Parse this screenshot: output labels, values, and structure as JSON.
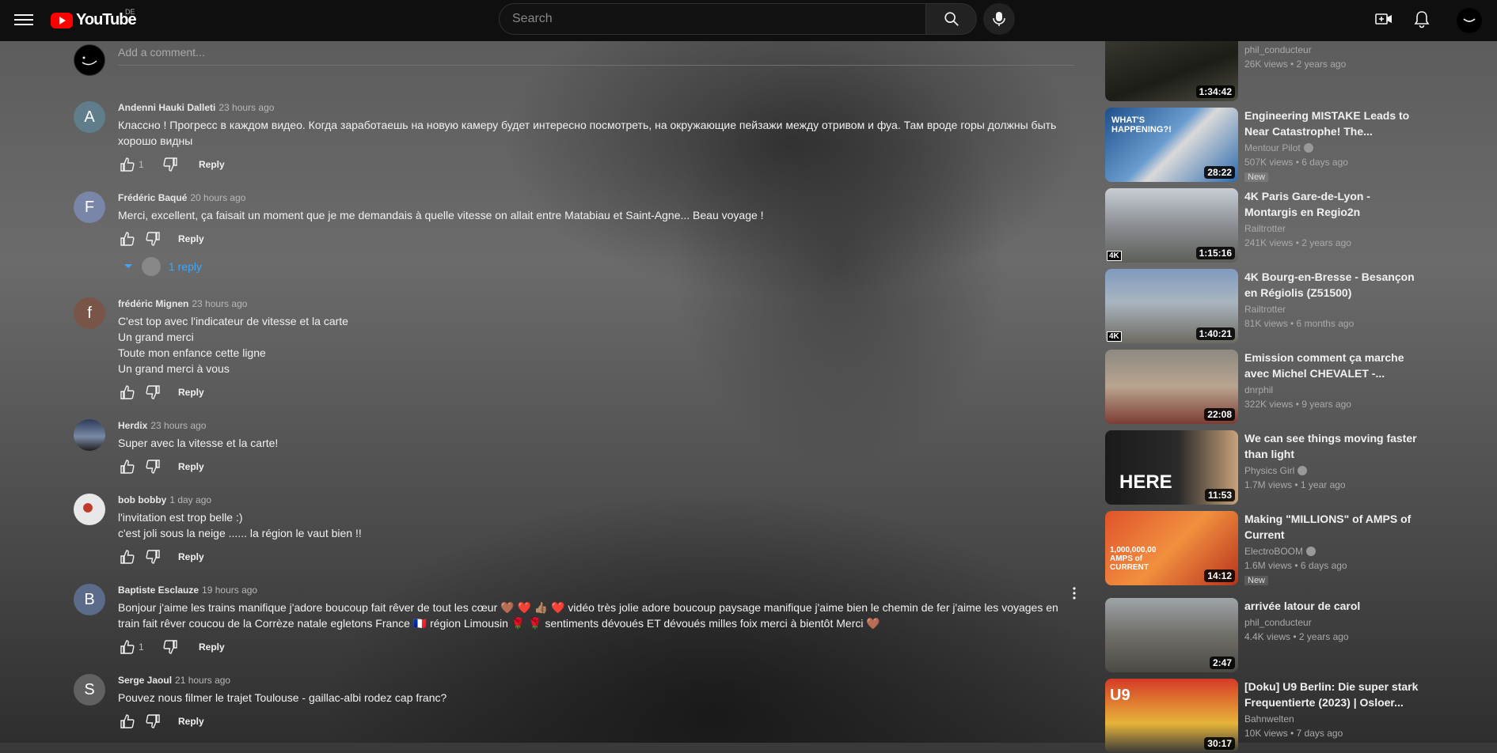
{
  "header": {
    "logo_text": "YouTube",
    "country_code": "DE",
    "search_placeholder": "Search"
  },
  "comments_section": {
    "add_comment_placeholder": "Add a comment...",
    "comments": [
      {
        "author": "Andenni Hauki Dalleti",
        "time": "23 hours ago",
        "avatar_letter": "A",
        "avatar_color": "#607d8b",
        "lines": [
          "Классно !  Прогресс в  каждом видео. Когда заработаешь на новую камеру будет интересно посмотреть, на окружающие пейзажи между отривом и фуа. Там вроде горы должны быть хорошо видны"
        ],
        "likes": "1",
        "reply_label": "Reply"
      },
      {
        "author": "Frédéric Baqué",
        "time": "20 hours ago",
        "avatar_letter": "F",
        "avatar_color": "#7986a8",
        "lines": [
          "Merci, excellent, ça faisait un moment que je me demandais à quelle vitesse on allait entre Matabiau et Saint-Agne... Beau voyage !"
        ],
        "likes": "",
        "reply_label": "Reply",
        "replies_label": "1 reply"
      },
      {
        "author": "frédéric Mignen",
        "time": "23 hours ago",
        "avatar_letter": "f",
        "avatar_color": "#795548",
        "lines": [
          "C'est top avec l'indicateur de vitesse et la carte",
          "Un grand merci",
          "Toute mon enfance cette ligne",
          "Un grand merci à vous"
        ],
        "likes": "",
        "reply_label": "Reply"
      },
      {
        "author": "Herdix",
        "time": "23 hours ago",
        "avatar_letter": "",
        "avatar_color": "#3b4a63",
        "lines": [
          "Super avec la vitesse et la carte!"
        ],
        "likes": "",
        "reply_label": "Reply"
      },
      {
        "author": "bob bobby",
        "time": "1 day ago",
        "avatar_letter": "",
        "avatar_color": "#d8d8d8",
        "lines": [
          "l'invitation est trop belle  :)",
          "c'est joli sous la neige ...... la région le vaut bien !!"
        ],
        "likes": "",
        "reply_label": "Reply"
      },
      {
        "author": "Baptiste Esclauze",
        "time": "19 hours ago",
        "avatar_letter": "B",
        "avatar_color": "#5c6b8a",
        "lines": [
          "Bonjour j'aime les trains manifique j'adore boucoup fait rêver de tout les cœur 🤎 ❤️ 👍🏽 ❤️  vidéo très jolie adore boucoup paysage manifique j'aime bien le chemin de fer j'aime les voyages en train fait rêver coucou de la Corrèze natale egletons France 🇫🇷 région Limousin  🌹 🌹  sentiments dévoués ET dévoués milles foix merci à bientôt Merci 🤎"
        ],
        "likes": "1",
        "reply_label": "Reply"
      },
      {
        "author": "Serge Jaoul",
        "time": "21 hours ago",
        "avatar_letter": "S",
        "avatar_color": "#616161",
        "lines": [
          "Pouvez nous filmer le trajet Toulouse - gaillac-albi rodez cap franc?"
        ],
        "likes": "",
        "reply_label": "Reply"
      }
    ]
  },
  "sidebar": {
    "videos": [
      {
        "title": "",
        "channel": "phil_conducteur",
        "meta": "26K views  •  2 years ago",
        "duration": "1:34:42",
        "thumb": "linear-gradient(160deg,#3d3d35,#1d1d18 60%,#4a4a40)"
      },
      {
        "title": "Engineering MISTAKE Leads to Near Catastrophe! The...",
        "channel": "Mentour Pilot",
        "verified": true,
        "meta": "507K views  •  6 days ago",
        "new": "New",
        "duration": "28:22",
        "thumb": "linear-gradient(135deg,#1f4f8a,#6a9ccf 45%,#d9d9d9 55%,#2c6bb0)",
        "thumb_text": "WHAT'S HAPPENING?!"
      },
      {
        "title": "4K Paris Gare-de-Lyon - Montargis en Regio2n",
        "channel": "Railtrotter",
        "meta": "241K views  •  2 years ago",
        "duration": "1:15:16",
        "thumb": "linear-gradient(180deg,#c9ced6,#8b8f93 50%,#5d5e58)",
        "badge": "4K"
      },
      {
        "title": "4K Bourg-en-Bresse - Besançon en Régiolis (Z51500)",
        "channel": "Railtrotter",
        "meta": "81K views  •  6 months ago",
        "duration": "1:40:21",
        "thumb": "linear-gradient(180deg,#7f9bbf,#aab5c0 45%,#6d6a60)",
        "badge": "4K"
      },
      {
        "title": "Emission comment ça marche avec Michel CHEVALET -...",
        "channel": "dnrphil",
        "meta": "322K views  •  9 years ago",
        "duration": "22:08",
        "thumb": "linear-gradient(180deg,#8d8a82,#b9a48f 50%,#7c3d33)"
      },
      {
        "title": "We can see things moving faster than light",
        "channel": "Physics Girl",
        "verified": true,
        "meta": "1.7M views  •  1 year ago",
        "duration": "11:53",
        "thumb": "linear-gradient(90deg,#1a1a1a,#2a2a2a 55%,#c8a27a)",
        "thumb_text": "HERE"
      },
      {
        "title": "Making \"MILLIONS\" of AMPS of Current",
        "channel": "ElectroBOOM",
        "verified": true,
        "meta": "1.6M views  •  6 days ago",
        "new": "New",
        "duration": "14:12",
        "thumb": "linear-gradient(135deg,#e0532b,#f1903f 50%,#b8321c)",
        "thumb_text": "1,000,000,00 AMPS of CURRENT"
      },
      {
        "title": "arrivée latour de carol",
        "channel": "phil_conducteur",
        "meta": "4.4K views  •  2 years ago",
        "duration": "2:47",
        "thumb": "linear-gradient(180deg,#9fa4a8,#6f6e68 50%,#4b4a44)"
      },
      {
        "title": "[Doku] U9 Berlin: Die super stark Frequentierte (2023) | Osloer...",
        "channel": "Bahnwelten",
        "meta": "10K views  •  7 days ago",
        "duration": "30:17",
        "thumb": "linear-gradient(180deg,#d63a26,#e7b43a 60%,#3a3a3a)",
        "thumb_text": "U9"
      }
    ]
  }
}
